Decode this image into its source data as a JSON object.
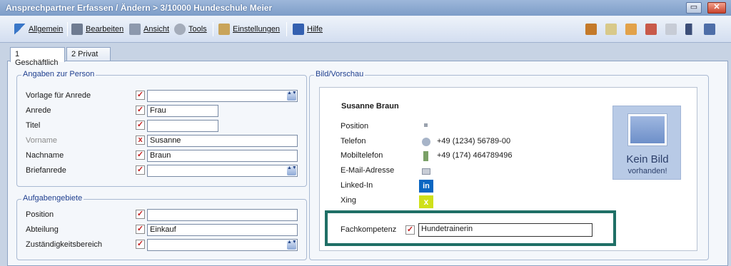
{
  "window": {
    "title": "Ansprechpartner Erfassen / Ändern > 3/10000 Hundeschule Meier",
    "minimize_glyph": "▭",
    "close_glyph": "✕"
  },
  "menu": [
    {
      "label": "Allgemein",
      "icon": "arrow-icon"
    },
    {
      "label": "Bearbeiten",
      "icon": "edit-icon"
    },
    {
      "label": "Ansicht",
      "icon": "view-icon"
    },
    {
      "label": "Tools",
      "icon": "tools-icon"
    },
    {
      "label": "Einstellungen",
      "icon": "settings-icon"
    },
    {
      "label": "Hilfe",
      "icon": "help-icon"
    }
  ],
  "tabs": [
    {
      "label": "1 Geschäftlich",
      "active": true
    },
    {
      "label": "2 Privat",
      "active": false
    }
  ],
  "person": {
    "legend": "Angaben zur Person",
    "fields": [
      {
        "label": "Vorlage für Anrede",
        "value": "",
        "dropdown": true
      },
      {
        "label": "Anrede",
        "value": "Frau"
      },
      {
        "label": "Titel",
        "value": ""
      },
      {
        "label": "Vorname",
        "value": "Susanne",
        "disabled": true
      },
      {
        "label": "Nachname",
        "value": "Braun"
      },
      {
        "label": "Briefanrede",
        "value": "",
        "dropdown": true
      }
    ]
  },
  "tasks": {
    "legend": "Aufgabengebiete",
    "fields": [
      {
        "label": "Position",
        "value": ""
      },
      {
        "label": "Abteilung",
        "value": "Einkauf"
      },
      {
        "label": "Zuständigkeitsbereich",
        "value": "",
        "dropdown": true
      }
    ]
  },
  "preview": {
    "legend": "Bild/Vorschau",
    "name": "Susanne Braun",
    "rows": [
      {
        "label": "Position",
        "value": ""
      },
      {
        "label": "Telefon",
        "value": "+49 (1234) 56789-00"
      },
      {
        "label": "Mobiltelefon",
        "value": "+49 (174) 464789496"
      },
      {
        "label": "E-Mail-Adresse",
        "value": ""
      },
      {
        "label": "Linked-In",
        "value": ""
      },
      {
        "label": "Xing",
        "value": ""
      }
    ],
    "no_picture_line1": "Kein Bild",
    "no_picture_line2": "vorhanden!",
    "fachkompetenz_label": "Fachkompetenz",
    "fachkompetenz_value": "Hundetrainerin"
  },
  "glyphs": {
    "check": "✓",
    "cross": "x",
    "spin": "▲▼"
  },
  "colors": {
    "highlight": "#1f6f66",
    "linkedin": "#0a66c2",
    "xing": "#cfe01a"
  }
}
